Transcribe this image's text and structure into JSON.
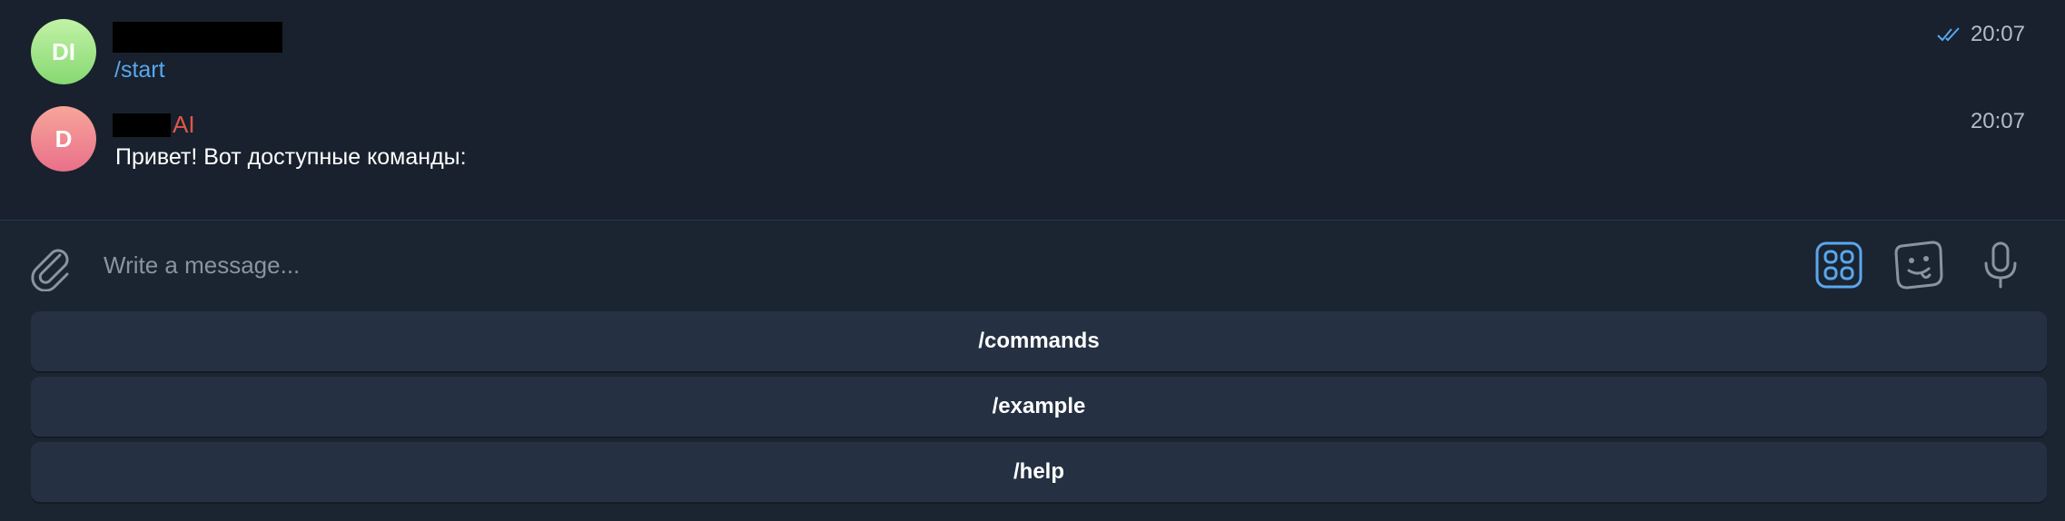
{
  "messages": [
    {
      "avatar_initials": "DI",
      "sender_suffix": "",
      "text": "/start",
      "time": "20:07",
      "read_receipt": true,
      "text_color": "#5aa7ed"
    },
    {
      "avatar_initials": "D",
      "sender_suffix": "AI",
      "text": "Привет! Вот доступные команды:",
      "time": "20:07",
      "read_receipt": false,
      "text_color": "#ffffff"
    }
  ],
  "composer": {
    "placeholder": "Write a message...",
    "icons": [
      "paperclip-icon",
      "apps-icon",
      "sticker-icon",
      "microphone-icon"
    ]
  },
  "keyboard": {
    "buttons": [
      "/commands",
      "/example",
      "/help"
    ]
  },
  "colors": {
    "background": "#1b2431",
    "accent": "#5aa7ed",
    "bot_name": "#e0564b",
    "button_bg": "#253142"
  }
}
